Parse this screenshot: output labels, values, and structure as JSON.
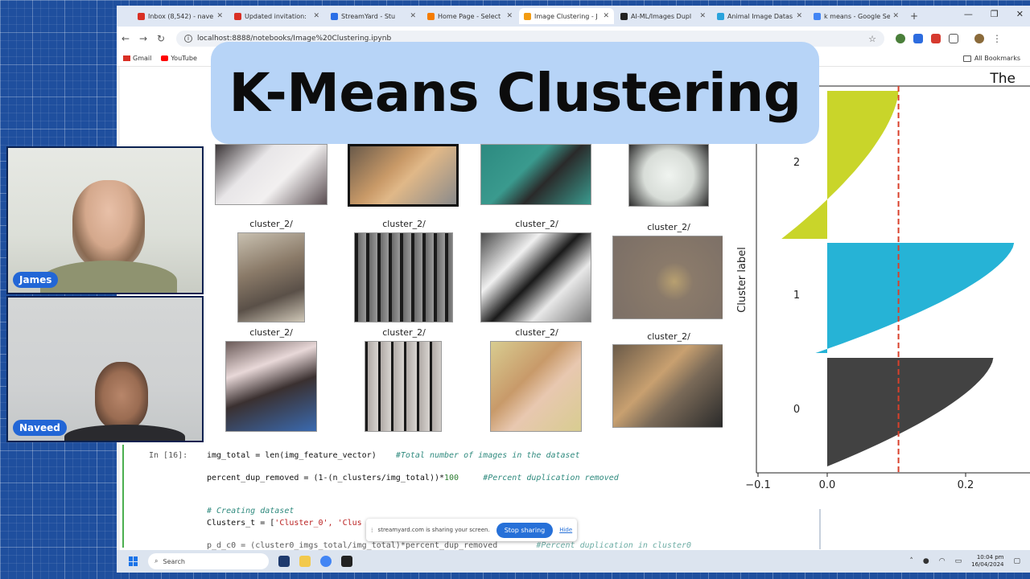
{
  "banner": {
    "title": "K-Means Clustering"
  },
  "browser": {
    "tabs": [
      {
        "label": "Inbox (8,542) - nave",
        "color": "#d93025",
        "active": false
      },
      {
        "label": "Updated invitation:",
        "color": "#d93025",
        "active": false
      },
      {
        "label": "StreamYard - Stu",
        "color": "#2a6ee6",
        "active": false
      },
      {
        "label": "Home Page - Select",
        "color": "#f57c00",
        "active": false
      },
      {
        "label": "Image Clustering - J",
        "color": "#f39c12",
        "active": true
      },
      {
        "label": "AI-ML/Images Dupl",
        "color": "#222222",
        "active": false
      },
      {
        "label": "Animal Image Datas",
        "color": "#2aa3dc",
        "active": false
      },
      {
        "label": "k means - Google Se",
        "color": "#4285f4",
        "active": false
      }
    ],
    "new_tab": "+",
    "url": "localhost:8888/notebooks/Image%20Clustering.ipynb",
    "bookmarks": [
      {
        "label": "Gmail",
        "color": "#d93025"
      },
      {
        "label": "YouTube",
        "color": "#ff0000"
      }
    ],
    "all_bookmarks": "All Bookmarks"
  },
  "notebook": {
    "captions": [
      "cluster_2/",
      "cluster_2/",
      "cluster_2/",
      "cluster_2/",
      "cluster_2/",
      "cluster_2/",
      "cluster_2/",
      "cluster_2/"
    ],
    "code": {
      "prompt": "In [16]:",
      "line1": "img_total = len(img_feature_vector)",
      "line1_comment": "#Total number of images in the dataset",
      "line2a": "percent_dup_removed = (1-(n_clusters/img_total))*",
      "line2_num": "100",
      "line2_comment": "#Percent duplication removed",
      "line3_comment": "# Creating dataset",
      "line4a": "Clusters_t = [",
      "line4_str": "'Cluster_0', 'Clus",
      "line5a": "p_d_c0 = (cluster0_imgs_total/img_total)*percent_dup_removed",
      "line5_comment": "#Percent duplication in cluster0"
    }
  },
  "share_bar": {
    "message": "streamyard.com is sharing your screen.",
    "stop": "Stop sharing",
    "hide": "Hide"
  },
  "taskbar": {
    "search": "Search",
    "time": "10:04 pm",
    "date": "16/04/2024"
  },
  "chart_data": {
    "type": "bar",
    "title": "The",
    "ylabel": "Cluster label",
    "xlabel": "",
    "xticks": [
      "-0.1",
      "0.0",
      "0.2"
    ],
    "xlim": [
      -0.1,
      0.28
    ],
    "threshold_line": 0.103,
    "series": [
      {
        "name": "2",
        "color": "#c9d52a",
        "min": -0.066,
        "max": 0.103
      },
      {
        "name": "1",
        "color": "#26b3d6",
        "min": -0.017,
        "max": 0.27
      },
      {
        "name": "0",
        "color": "#424242",
        "min": 0.0,
        "max": 0.24
      }
    ]
  },
  "webcams": [
    {
      "name": "James"
    },
    {
      "name": "Naveed"
    }
  ]
}
